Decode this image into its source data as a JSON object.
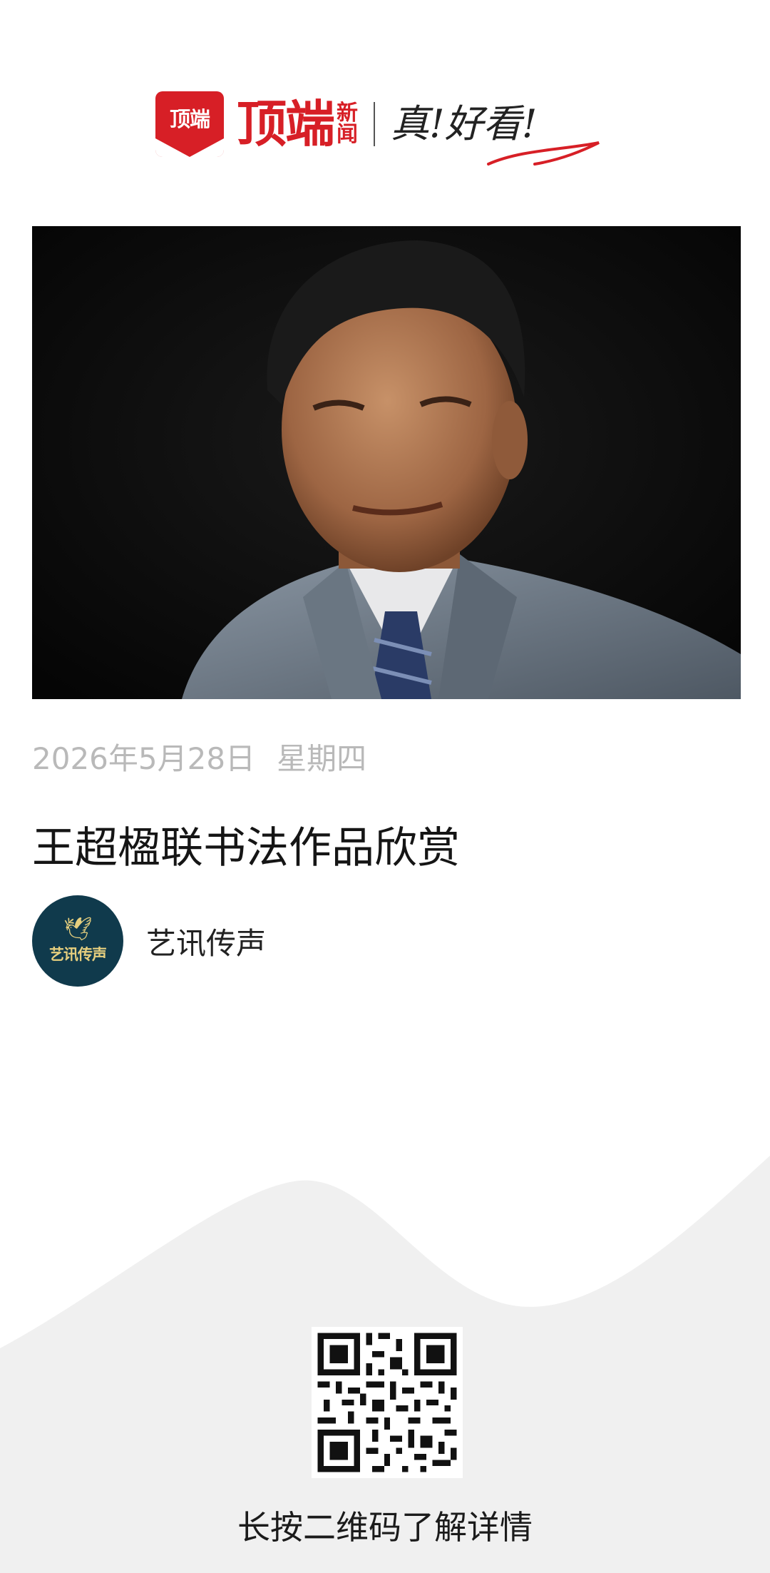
{
  "header": {
    "badge_text": "顶端",
    "brand_name": "顶端",
    "brand_sub_1": "新",
    "brand_sub_2": "闻",
    "slogan": "真!好看!",
    "brand_color": "#d71f26"
  },
  "hero": {
    "icon": "portrait-photo"
  },
  "article": {
    "date": "2026年5月28日",
    "weekday": "星期四",
    "title": "王超楹联书法作品欣赏"
  },
  "author": {
    "avatar_text": "艺讯传声",
    "name": "艺讯传声",
    "avatar_color": "#103a4c"
  },
  "footer": {
    "qr_icon": "qr-code-icon",
    "caption": "长按二维码了解详情",
    "background": "#f0f0f0"
  }
}
